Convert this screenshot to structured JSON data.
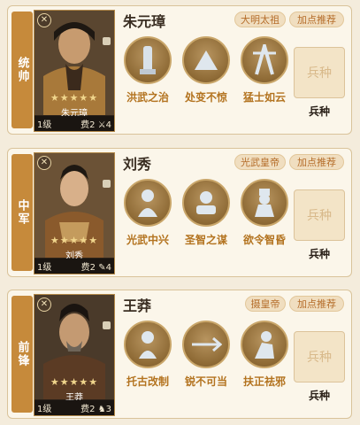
{
  "panels": [
    {
      "position": "统帅",
      "hero": {
        "name": "朱元璋",
        "title": "大明太祖",
        "level": "1级",
        "cost": "费2",
        "count": "4"
      },
      "recommend": "加点推荐",
      "skills": [
        "洪武之治",
        "处变不惊",
        "猛士如云"
      ],
      "troop": {
        "slot": "兵种",
        "label": "兵种"
      }
    },
    {
      "position": "中军",
      "hero": {
        "name": "刘秀",
        "title": "光武皇帝",
        "level": "1级",
        "cost": "费2",
        "count": "4"
      },
      "recommend": "加点推荐",
      "skills": [
        "光武中兴",
        "圣智之谋",
        "欲令智昏"
      ],
      "troop": {
        "slot": "兵种",
        "label": "兵种"
      }
    },
    {
      "position": "前锋",
      "hero": {
        "name": "王莽",
        "title": "摄皇帝",
        "level": "1级",
        "cost": "费2",
        "count": "3"
      },
      "recommend": "加点推荐",
      "skills": [
        "托古改制",
        "锐不可当",
        "扶正祛邪"
      ],
      "troop": {
        "slot": "兵种",
        "label": "兵种"
      }
    }
  ],
  "stars": "★★★★★",
  "icons": {
    "close": "close-icon",
    "weapon": "weapon-icon",
    "skill": "skill-icon"
  }
}
